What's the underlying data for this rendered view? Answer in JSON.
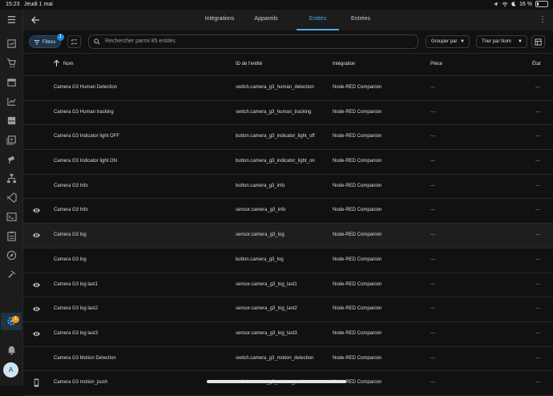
{
  "status": {
    "time": "15:23",
    "date": "Jeudi 1 mai",
    "battery": "16 %"
  },
  "tabs": [
    {
      "label": "Intégrations"
    },
    {
      "label": "Appareils"
    },
    {
      "label": "Entités"
    },
    {
      "label": "Entrées"
    }
  ],
  "toolbar": {
    "filters_label": "Filtres",
    "filters_count": "1",
    "search_placeholder": "Rechercher parmi 85 entités",
    "group_by": "Grouper par",
    "sort_by": "Trier par Nom"
  },
  "columns": {
    "name": "Nom",
    "entity_id": "ID de l'entité",
    "integration": "Intégration",
    "area": "Pièce",
    "status": "État"
  },
  "rows": [
    {
      "name": "Camera G3 Human Detection",
      "entity_id": "switch.camera_g3_human_detection",
      "integration": "Node-RED Companion",
      "area": "—",
      "status": "—",
      "icon": ""
    },
    {
      "name": "Camera G3 Human tracking",
      "entity_id": "switch.camera_g3_human_tracking",
      "integration": "Node-RED Companion",
      "area": "—",
      "status": "—",
      "icon": ""
    },
    {
      "name": "Camera G3 Indicator light OFF",
      "entity_id": "button.camera_g3_indicator_light_off",
      "integration": "Node-RED Companion",
      "area": "—",
      "status": "—",
      "icon": ""
    },
    {
      "name": "Camera G3 Indicator light ON",
      "entity_id": "button.camera_g3_indicator_light_on",
      "integration": "Node-RED Companion",
      "area": "—",
      "status": "—",
      "icon": ""
    },
    {
      "name": "Camera G3 Info",
      "entity_id": "button.camera_g3_info",
      "integration": "Node-RED Companion",
      "area": "—",
      "status": "—",
      "icon": ""
    },
    {
      "name": "Camera G3 Info",
      "entity_id": "sensor.camera_g3_info",
      "integration": "Node-RED Companion",
      "area": "—",
      "status": "—",
      "icon": "eye-icon"
    },
    {
      "name": "Camera G3 log",
      "entity_id": "sensor.camera_g3_log",
      "integration": "Node-RED Companion",
      "area": "—",
      "status": "—",
      "icon": "eye-icon"
    },
    {
      "name": "Camera G3 log",
      "entity_id": "button.camera_g3_log",
      "integration": "Node-RED Companion",
      "area": "—",
      "status": "—",
      "icon": ""
    },
    {
      "name": "Camera G3 log last1",
      "entity_id": "sensor.camera_g3_log_last1",
      "integration": "Node-RED Companion",
      "area": "—",
      "status": "—",
      "icon": "eye-icon"
    },
    {
      "name": "Camera G3 log last2",
      "entity_id": "sensor.camera_g3_log_last2",
      "integration": "Node-RED Companion",
      "area": "—",
      "status": "—",
      "icon": "eye-icon"
    },
    {
      "name": "Camera G3 log last3",
      "entity_id": "sensor.camera_g3_log_last3",
      "integration": "Node-RED Companion",
      "area": "—",
      "status": "—",
      "icon": "eye-icon"
    },
    {
      "name": "Camera G3 Motion Detection",
      "entity_id": "switch.camera_g3_motion_detection",
      "integration": "Node-RED Companion",
      "area": "—",
      "status": "—",
      "icon": ""
    },
    {
      "name": "Camera G3 motion_push",
      "entity_id": "switch.camera_g3_motion_push",
      "integration": "Node-RED Companion",
      "area": "—",
      "status": "—",
      "icon": "phone-icon"
    }
  ],
  "user": {
    "avatar_letter": "A"
  },
  "settings_badge": "1",
  "colors": {
    "accent": "#4fa9e6",
    "badge_blue": "#1e88e5",
    "badge_orange": "#ff9800",
    "background": "#111111"
  }
}
